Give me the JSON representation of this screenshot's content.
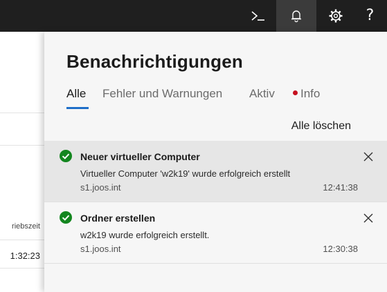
{
  "topbar": {
    "icons": [
      "powershell-icon",
      "bell-icon",
      "gear-icon",
      "help-icon"
    ],
    "help_label": "?"
  },
  "background_page": {
    "column_header_fragment": "riebszeit",
    "value_fragment": "1:32:23"
  },
  "panel": {
    "title": "Benachrichtigungen",
    "tabs": [
      {
        "label": "Alle",
        "selected": true
      },
      {
        "label": "Fehler und Warnungen",
        "selected": false
      },
      {
        "label": "Aktiv",
        "selected": false
      },
      {
        "label": "Info",
        "selected": false,
        "indicator_color": "#c50f1f"
      }
    ],
    "clear_all_label": "Alle löschen",
    "accent_color": "#1e6ec8"
  },
  "notifications": [
    {
      "status": "success",
      "status_color": "#13861f",
      "title": "Neuer virtueller Computer",
      "message": "Virtueller Computer 'w2k19' wurde erfolgreich erstellt",
      "server": "s1.joos.int",
      "time": "12:41:38"
    },
    {
      "status": "success",
      "status_color": "#13861f",
      "title": "Ordner erstellen",
      "message": "w2k19 wurde erfolgreich erstellt.",
      "server": "s1.joos.int",
      "time": "12:30:38"
    }
  ]
}
